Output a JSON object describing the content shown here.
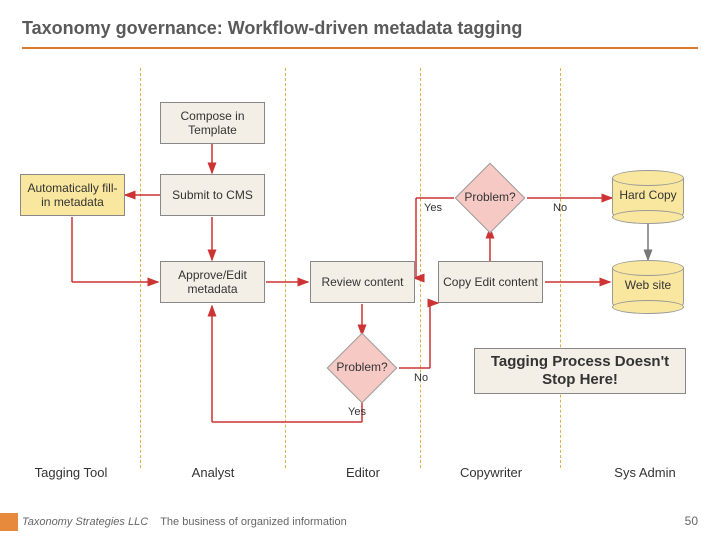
{
  "title": "Taxonomy governance: Workflow-driven metadata tagging",
  "nodes": {
    "compose": "Compose in Template",
    "auto_fill": "Automatically fill-in metadata",
    "submit": "Submit to CMS",
    "approve": "Approve/Edit metadata",
    "review": "Review content",
    "copyedit": "Copy Edit content",
    "problem_top": "Problem?",
    "problem_bot": "Problem?",
    "hardcopy": "Hard Copy",
    "website": "Web site"
  },
  "edge_labels": {
    "yes_top": "Yes",
    "no_top": "No",
    "yes_bot": "Yes",
    "no_bot": "No"
  },
  "callout": "Tagging Process Doesn't Stop Here!",
  "roles": {
    "tagging_tool": "Tagging Tool",
    "analyst": "Analyst",
    "editor": "Editor",
    "copywriter": "Copywriter",
    "sysadmin": "Sys Admin"
  },
  "footer": {
    "company": "Taxonomy Strategies LLC",
    "tagline": "The business of organized information"
  },
  "page": "50",
  "chart_data": {
    "type": "flowchart",
    "title": "Taxonomy governance: Workflow-driven metadata tagging",
    "lanes": [
      "Tagging Tool",
      "Analyst",
      "Editor",
      "Copywriter",
      "Sys Admin"
    ],
    "nodes": [
      {
        "id": "compose",
        "label": "Compose in Template",
        "lane": "Analyst",
        "type": "process"
      },
      {
        "id": "auto_fill",
        "label": "Automatically fill-in metadata",
        "lane": "Tagging Tool",
        "type": "process"
      },
      {
        "id": "submit",
        "label": "Submit to CMS",
        "lane": "Analyst",
        "type": "process"
      },
      {
        "id": "approve",
        "label": "Approve/Edit metadata",
        "lane": "Analyst",
        "type": "process"
      },
      {
        "id": "review",
        "label": "Review content",
        "lane": "Editor",
        "type": "process"
      },
      {
        "id": "problem_bot",
        "label": "Problem?",
        "lane": "Editor",
        "type": "decision"
      },
      {
        "id": "copyedit",
        "label": "Copy Edit content",
        "lane": "Copywriter",
        "type": "process"
      },
      {
        "id": "problem_top",
        "label": "Problem?",
        "lane": "Copywriter",
        "type": "decision"
      },
      {
        "id": "hardcopy",
        "label": "Hard Copy",
        "lane": "Sys Admin",
        "type": "datastore"
      },
      {
        "id": "website",
        "label": "Web site",
        "lane": "Sys Admin",
        "type": "datastore"
      }
    ],
    "edges": [
      {
        "from": "compose",
        "to": "submit"
      },
      {
        "from": "submit",
        "to": "auto_fill"
      },
      {
        "from": "auto_fill",
        "to": "approve"
      },
      {
        "from": "submit",
        "to": "approve"
      },
      {
        "from": "approve",
        "to": "review"
      },
      {
        "from": "review",
        "to": "problem_bot"
      },
      {
        "from": "problem_bot",
        "to": "approve",
        "label": "Yes"
      },
      {
        "from": "problem_bot",
        "to": "copyedit",
        "label": "No"
      },
      {
        "from": "copyedit",
        "to": "problem_top"
      },
      {
        "from": "problem_top",
        "to": "review",
        "label": "Yes"
      },
      {
        "from": "problem_top",
        "to": "hardcopy",
        "label": "No"
      },
      {
        "from": "problem_top",
        "to": "website",
        "label": "No"
      },
      {
        "from": "copyedit",
        "to": "website"
      }
    ],
    "annotation": "Tagging Process Doesn't Stop Here!"
  }
}
